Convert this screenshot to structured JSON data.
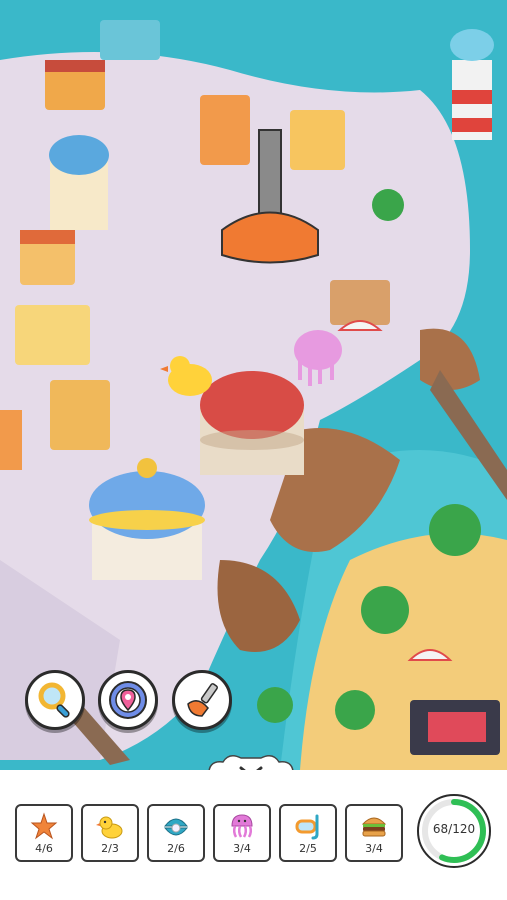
{
  "tools": [
    {
      "name": "magnifier-icon"
    },
    {
      "name": "compass-pin-icon"
    },
    {
      "name": "plunger-icon"
    }
  ],
  "items": [
    {
      "icon": "starfish-icon",
      "label": "4/6",
      "color": "#f0843a"
    },
    {
      "icon": "rubber-duck-icon",
      "label": "2/3",
      "color": "#ffd23a"
    },
    {
      "icon": "pearl-clam-icon",
      "label": "2/6",
      "color": "#2fa7c4"
    },
    {
      "icon": "jellyfish-icon",
      "label": "3/4",
      "color": "#e27ad8"
    },
    {
      "icon": "snorkel-mask-icon",
      "label": "2/5",
      "color": "#f39a2e"
    },
    {
      "icon": "burger-icon",
      "label": "3/4",
      "color": "#c56d27"
    }
  ],
  "progress": {
    "text": "68/120",
    "found": 68,
    "total": 120,
    "color": "#2fbf55"
  },
  "colors": {
    "water": "#3ab8c9",
    "plaza": "#e5dbe9",
    "sand": "#f3cc7a",
    "accent": "#f07a32"
  }
}
